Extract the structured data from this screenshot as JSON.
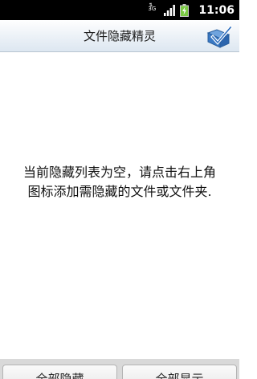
{
  "status_bar": {
    "network_type": "3G",
    "time": "11:06",
    "icons": [
      "data-activity-icon",
      "signal-strength-icon",
      "battery-charging-icon"
    ]
  },
  "title_bar": {
    "title": "文件隐藏精灵",
    "action_icon": "folder-check-icon"
  },
  "empty_state": {
    "line1": "当前隐藏列表为空，请点击右上角",
    "line2": "图标添加需隐藏的文件或文件夹."
  },
  "bottom_bar": {
    "hide_all_label": "全部隐藏",
    "show_all_label": "全部显示"
  },
  "colors": {
    "title_bar_gradient": "#dde7f1",
    "check_accent": "#2f6fbf",
    "battery_green": "#7ac943"
  }
}
